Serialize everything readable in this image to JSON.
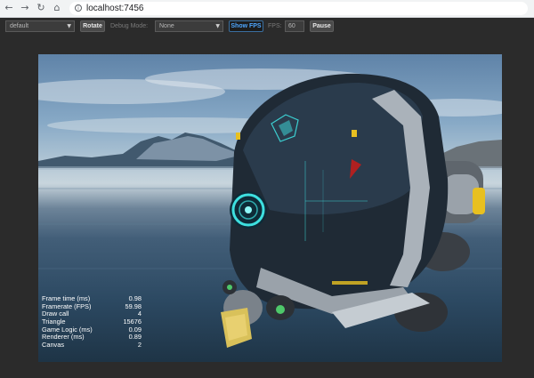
{
  "browser": {
    "back_icon": "arrow-left-icon",
    "forward_icon": "arrow-right-icon",
    "reload_icon": "reload-icon",
    "home_icon": "home-icon",
    "url": "localhost:7456"
  },
  "toolbar": {
    "scene_select": "default",
    "rotate_label": "Rotate",
    "debug_mode_label": "Debug Mode:",
    "debug_mode_select": "None",
    "show_fps_label": "Show FPS",
    "fps_label": "FPS:",
    "fps_value": "60",
    "pause_label": "Pause"
  },
  "stats": [
    {
      "label": "Frame time (ms)",
      "value": "0.98"
    },
    {
      "label": "Framerate (FPS)",
      "value": "59.98"
    },
    {
      "label": "Draw call",
      "value": "4"
    },
    {
      "label": "Triangle",
      "value": "15676"
    },
    {
      "label": "Game Logic (ms)",
      "value": "0.09"
    },
    {
      "label": "Renderer (ms)",
      "value": "0.89"
    },
    {
      "label": "Canvas",
      "value": "2"
    }
  ],
  "colors": {
    "active_button_text": "#4da6ff",
    "hud_cyan": "#3ee0e0",
    "robot_accent_yellow": "#e8c020"
  }
}
